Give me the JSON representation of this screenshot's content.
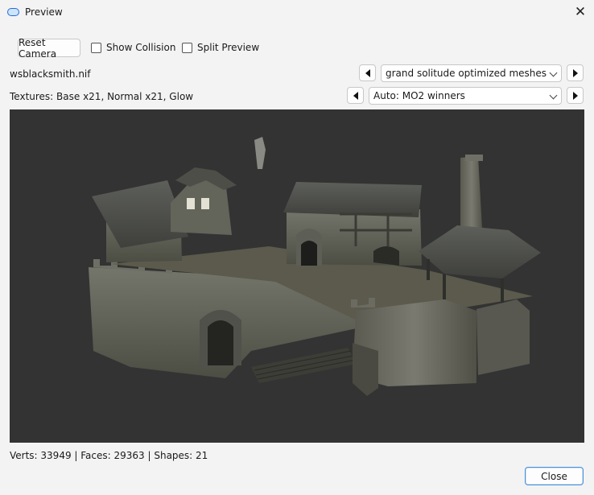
{
  "window": {
    "title": "Preview",
    "app_icon": "preview-app-icon",
    "close_icon": "close-icon"
  },
  "toolbar": {
    "reset_camera_label": "Reset Camera",
    "show_collision_label": "Show Collision",
    "show_collision_checked": false,
    "split_preview_label": "Split Preview",
    "split_preview_checked": false
  },
  "mesh": {
    "file_name": "wsblacksmith.nif",
    "source_selected": "grand solitude optimized meshes"
  },
  "textures": {
    "summary": "Textures: Base x21, Normal x21, Glow",
    "source_selected": "Auto: MO2 winners"
  },
  "stats": {
    "text": "Verts: 33949 | Faces: 29363 | Shapes: 21"
  },
  "footer": {
    "close_label": "Close"
  },
  "colors": {
    "viewport_bg": "#333333",
    "accent": "#1e6fd9"
  }
}
